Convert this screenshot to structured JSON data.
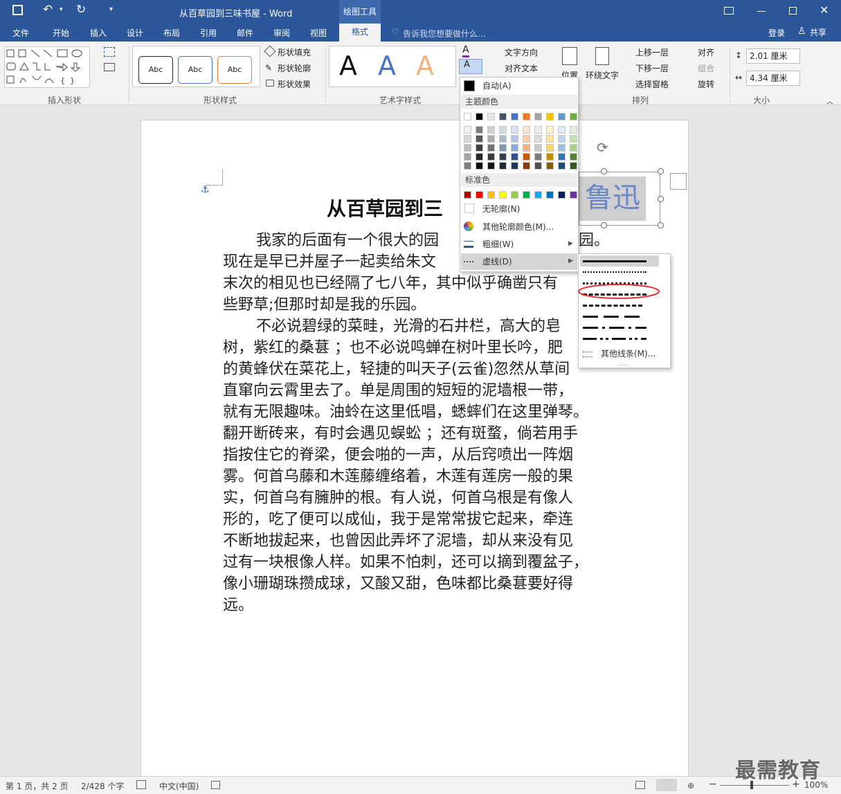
{
  "window": {
    "title": "从百草园到三味书屋 - Word",
    "context_tab": "绘图工具"
  },
  "tabs": [
    "文件",
    "开始",
    "插入",
    "设计",
    "布局",
    "引用",
    "邮件",
    "审阅",
    "视图",
    "格式"
  ],
  "active_tab": "格式",
  "tell_me": "告诉我您想要做什么...",
  "account": {
    "login": "登录",
    "share": "共享"
  },
  "ribbon": {
    "groups": {
      "insert_shapes": "插入形状",
      "shape_styles": "形状样式",
      "art_styles": "艺术字样式",
      "arrange": "排列",
      "size": "大小"
    },
    "shape_fill": "形状填充",
    "shape_outline": "形状轮廓",
    "shape_effect": "形状效果",
    "abc": "Abc",
    "text_direction": "文字方向",
    "align_text": "对齐文本",
    "position": "位置",
    "wrap_text": "环绕文字",
    "bring_forward": "上移一层",
    "send_backward": "下移一层",
    "selection_pane": "选择窗格",
    "align": "对齐",
    "group": "组合",
    "rotate": "旋转",
    "height": "2.01 厘米",
    "width": "4.34 厘米",
    "letter_a": "A"
  },
  "outline_menu": {
    "auto": "自动(A)",
    "theme_colors": "主题颜色",
    "standard_colors": "标准色",
    "no_outline": "无轮廓(N)",
    "more_colors": "其他轮廓颜色(M)...",
    "weight": "粗细(W)",
    "dashes": "虚线(D)",
    "theme_top": [
      "#ffffff",
      "#000000",
      "#e7e6e6",
      "#44546a",
      "#4472c4",
      "#ed7d31",
      "#a5a5a5",
      "#ffc000",
      "#5b9bd5",
      "#70ad47"
    ],
    "theme_shades": [
      [
        "#f2f2f2",
        "#7f7f7f",
        "#d0cece",
        "#d6dce4",
        "#d9e2f3",
        "#fbe5d5",
        "#ededed",
        "#fff2cc",
        "#deebf6",
        "#e2efd9"
      ],
      [
        "#d8d8d8",
        "#595959",
        "#aeabab",
        "#adb9ca",
        "#b4c6e7",
        "#f7cbac",
        "#dbdbdb",
        "#fee599",
        "#bdd7ee",
        "#c5e0b3"
      ],
      [
        "#bfbfbf",
        "#3f3f3f",
        "#757070",
        "#8496b0",
        "#8eaadb",
        "#f4b183",
        "#c9c9c9",
        "#ffd965",
        "#9cc3e5",
        "#a8d08d"
      ],
      [
        "#a5a5a5",
        "#262626",
        "#3a3838",
        "#323f4f",
        "#2f5496",
        "#c55a11",
        "#7b7b7b",
        "#bf8f00",
        "#2e75b5",
        "#538135"
      ],
      [
        "#7f7f7f",
        "#0c0c0c",
        "#171616",
        "#222a35",
        "#1f3864",
        "#833c0b",
        "#525252",
        "#7f6000",
        "#1e4e79",
        "#375623"
      ]
    ],
    "standard": [
      "#c00000",
      "#ff0000",
      "#ffc000",
      "#ffff00",
      "#92d050",
      "#00b050",
      "#00b0f0",
      "#0070c0",
      "#002060",
      "#7030a0"
    ]
  },
  "dash_menu": {
    "more_lines": "其他线条(M)..."
  },
  "document": {
    "title": "从百草园到三",
    "wordart": "鲁迅",
    "paragraphs": [
      "我家的后面有一个很大的园",
      "园。",
      "现在是早已并屋子一起卖给朱文",
      "末次的相见也已经隔了七八年，其中似乎确凿只有",
      "些野草;但那时却是我的乐园。",
      "不必说碧绿的菜畦，光滑的石井栏，高大的皂",
      "树，紫红的桑葚 ；也不必说鸣蝉在树叶里长吟，肥",
      "的黄蜂伏在菜花上，轻捷的叫天子(云雀)忽然从草间",
      "直窜向云霄里去了。单是周围的短短的泥墙根一带，",
      "就有无限趣味。油蛉在这里低唱，蟋蟀们在这里弹琴。",
      "翻开断砖来，有时会遇见蜈蚣 ；还有斑蝥，倘若用手",
      "指按住它的脊梁，便会啪的一声，从后窍喷出一阵烟",
      "雾。何首乌藤和木莲藤缠络着，木莲有莲房一般的果",
      "实，何首乌有臃肿的根。有人说，何首乌根是有像人",
      "形的，吃了便可以成仙，我于是常常拔它起来，牵连",
      "不断地拔起来，也曾因此弄坏了泥墙，却从来没有见",
      "过有一块根像人样。如果不怕刺，还可以摘到覆盆子，",
      "像小珊瑚珠攒成球，又酸又甜，色味都比桑葚要好得",
      "远。"
    ]
  },
  "status": {
    "page": "第 1 页，共 2 页",
    "words": "2/428 个字",
    "lang": "中文(中国)",
    "zoom": "100%"
  },
  "watermark": "最需教育"
}
